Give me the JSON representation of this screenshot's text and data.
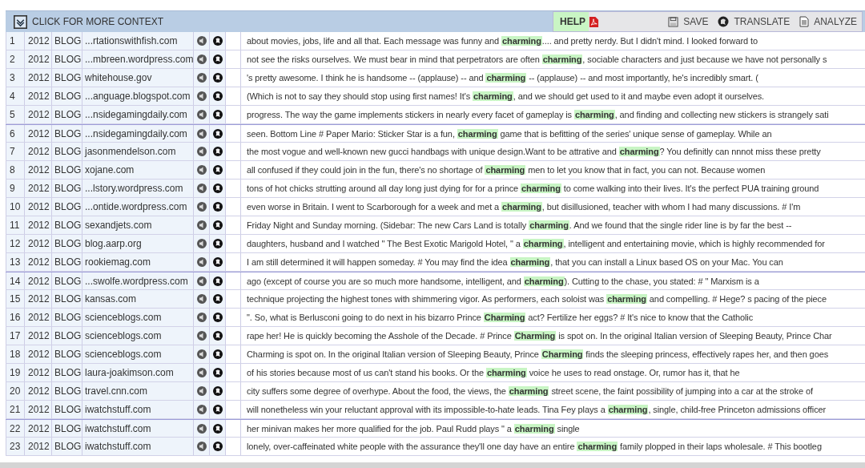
{
  "toolbar": {
    "context_label": "CLICK FOR MORE CONTEXT",
    "help": "HELP",
    "actions": [
      {
        "kind": "save",
        "label": "SAVE"
      },
      {
        "kind": "translate",
        "label": "TRANSLATE"
      },
      {
        "kind": "analyze",
        "label": "ANALYZE"
      }
    ]
  },
  "rows": [
    {
      "number": "1",
      "year": "2012",
      "genre": "BLOG",
      "source": "...rtationswithfish.com",
      "text": "about movies, jobs, life and all that. Each message was funny and **charming**.... and pretty nerdy. But I didn't mind. I looked forward to"
    },
    {
      "number": "2",
      "year": "2012",
      "genre": "BLOG",
      "source": "...mbreen.wordpress.com",
      "text": "not see the risks ourselves. We must bear in mind that perpetrators are often **charming**, sociable characters and just because we have not personally s"
    },
    {
      "number": "3",
      "year": "2012",
      "genre": "BLOG",
      "source": "whitehouse.gov",
      "text": "'s pretty awesome. I think he is handsome -- (applause) -- and **charming** -- (applause) -- and most importantly, he's incredibly smart. ("
    },
    {
      "number": "4",
      "year": "2012",
      "genre": "BLOG",
      "source": "...anguage.blogspot.com",
      "text": "(Which is not to say they should stop using first names! It's **charming**, and we should get used to it and maybe even adopt it ourselves."
    },
    {
      "number": "5",
      "year": "2012",
      "genre": "BLOG",
      "source": "...nsidegamingdaily.com",
      "text": "progress. The way the game implements stickers in nearly every facet of gameplay is **charming**, and finding and collecting new stickers is strangely sati"
    },
    {
      "number": "6",
      "year": "2012",
      "genre": "BLOG",
      "source": "...nsidegamingdaily.com",
      "text": "seen. Bottom Line # Paper Mario: Sticker Star is a fun, **charming** game that is befitting of the series' unique sense of gameplay. While an"
    },
    {
      "number": "7",
      "year": "2012",
      "genre": "BLOG",
      "source": "jasonmendelson.com",
      "text": "the most vogue and well-known new gucci handbags with unique design.Want to be attrative and **charming**? You definitly can nnnot miss these pretty"
    },
    {
      "number": "8",
      "year": "2012",
      "genre": "BLOG",
      "source": "xojane.com",
      "text": "all confused if they could join in the fun, there's no shortage of **charming** men to let you know that in fact, you can not. Because women"
    },
    {
      "number": "9",
      "year": "2012",
      "genre": "BLOG",
      "source": "...lstory.wordpress.com",
      "text": "tons of hot chicks strutting around all day long just dying for for a prince **charming** to come walking into their lives. It's the perfect PUA training ground"
    },
    {
      "number": "10",
      "year": "2012",
      "genre": "BLOG",
      "source": "...ontide.wordpress.com",
      "text": "even worse in Britain. I went to Scarborough for a week and met a **charming**, but disillusioned, teacher with whom I had many discussions. # I'm"
    },
    {
      "number": "11",
      "year": "2012",
      "genre": "BLOG",
      "source": "sexandjets.com",
      "text": "Friday Night and Sunday morning. (Sidebar: The new Cars Land is totally **charming**. And we found that the single rider line is by far the best --"
    },
    {
      "number": "12",
      "year": "2012",
      "genre": "BLOG",
      "source": "blog.aarp.org",
      "text": "daughters, husband and I watched \" The Best Exotic Marigold Hotel, \" a **charming**, intelligent and entertaining movie, which is highly recommended for"
    },
    {
      "number": "13",
      "year": "2012",
      "genre": "BLOG",
      "source": "rookiemag.com",
      "text": "I am still determined it will happen someday. # You may find the idea **charming**, that you can install a Linux based OS on your Mac. You can"
    },
    {
      "number": "14",
      "year": "2012",
      "genre": "BLOG",
      "source": "...swolfe.wordpress.com",
      "text": "ago (except of course you are so much more handsome, intelligent, and **charming**). Cutting to the chase, you stated: # \" Marxism is a"
    },
    {
      "number": "15",
      "year": "2012",
      "genre": "BLOG",
      "source": "kansas.com",
      "text": "technique projecting the highest tones with shimmering vigor. As performers, each soloist was **charming** and compelling. # Hege? s pacing of the piece"
    },
    {
      "number": "16",
      "year": "2012",
      "genre": "BLOG",
      "source": "scienceblogs.com",
      "text": "\". So, what is Berlusconi going to do next in his bizarro Prince **Charming** act? Fertilize her eggs? # It's nice to know that the Catholic"
    },
    {
      "number": "17",
      "year": "2012",
      "genre": "BLOG",
      "source": "scienceblogs.com",
      "text": "rape her! He is quickly becoming the Asshole of the Decade. # Prince **Charming** is spot on. In the original Italian version of Sleeping Beauty, Prince Char"
    },
    {
      "number": "18",
      "year": "2012",
      "genre": "BLOG",
      "source": "scienceblogs.com",
      "text": "Charming is spot on. In the original Italian version of Sleeping Beauty, Prince **Charming** finds the sleeping princess, effectively rapes her, and then goes"
    },
    {
      "number": "19",
      "year": "2012",
      "genre": "BLOG",
      "source": "laura-joakimson.com",
      "text": "of his stories because most of us can't stand his books. Or the **charming** voice he uses to read onstage. Or, rumor has it, that he"
    },
    {
      "number": "20",
      "year": "2012",
      "genre": "BLOG",
      "source": "travel.cnn.com",
      "text": "city suffers some degree of overhype. About the food, the views, the **charming** street scene, the faint possibility of jumping into a car at the stroke of"
    },
    {
      "number": "21",
      "year": "2012",
      "genre": "BLOG",
      "source": "iwatchstuff.com",
      "text": "will nonetheless win your reluctant approval with its impossible-to-hate leads. Tina Fey plays a **charming**, single, child-free Princeton admissions officer"
    },
    {
      "number": "22",
      "year": "2012",
      "genre": "BLOG",
      "source": "iwatchstuff.com",
      "text": "her minivan makes her more qualified for the job. Paul Rudd plays \" a **charming** single"
    },
    {
      "number": "23",
      "year": "2012",
      "genre": "BLOG",
      "source": "iwatchstuff.com",
      "text": "lonely, over-caffeinated white people with the assurance they'll one day have an entire **charming** family plopped in their laps wholesale. # This bootleg"
    }
  ]
}
